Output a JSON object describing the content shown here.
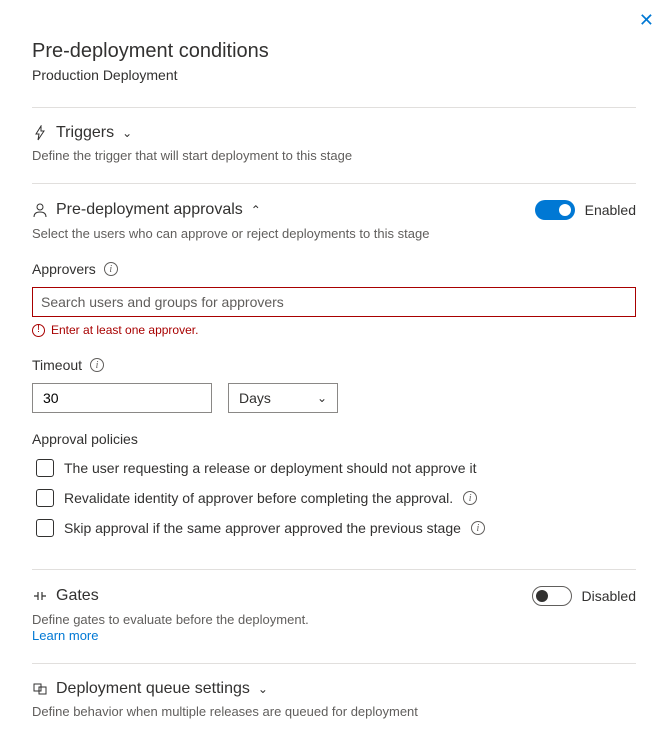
{
  "close_label": "✕",
  "page": {
    "title": "Pre-deployment conditions",
    "subtitle": "Production Deployment"
  },
  "triggers": {
    "title": "Triggers",
    "desc": "Define the trigger that will start deployment to this stage"
  },
  "approvals": {
    "title": "Pre-deployment approvals",
    "desc": "Select the users who can approve or reject deployments to this stage",
    "toggle_label": "Enabled",
    "approvers_label": "Approvers",
    "search_placeholder": "Search users and groups for approvers",
    "error_text": "Enter at least one approver.",
    "timeout_label": "Timeout",
    "timeout_value": "30",
    "timeout_unit": "Days",
    "policies_title": "Approval policies",
    "policies": [
      "The user requesting a release or deployment should not approve it",
      "Revalidate identity of approver before completing the approval.",
      "Skip approval if the same approver approved the previous stage"
    ]
  },
  "gates": {
    "title": "Gates",
    "desc": "Define gates to evaluate before the deployment.",
    "learn_more": "Learn more",
    "toggle_label": "Disabled"
  },
  "queue": {
    "title": "Deployment queue settings",
    "desc": "Define behavior when multiple releases are queued for deployment"
  }
}
